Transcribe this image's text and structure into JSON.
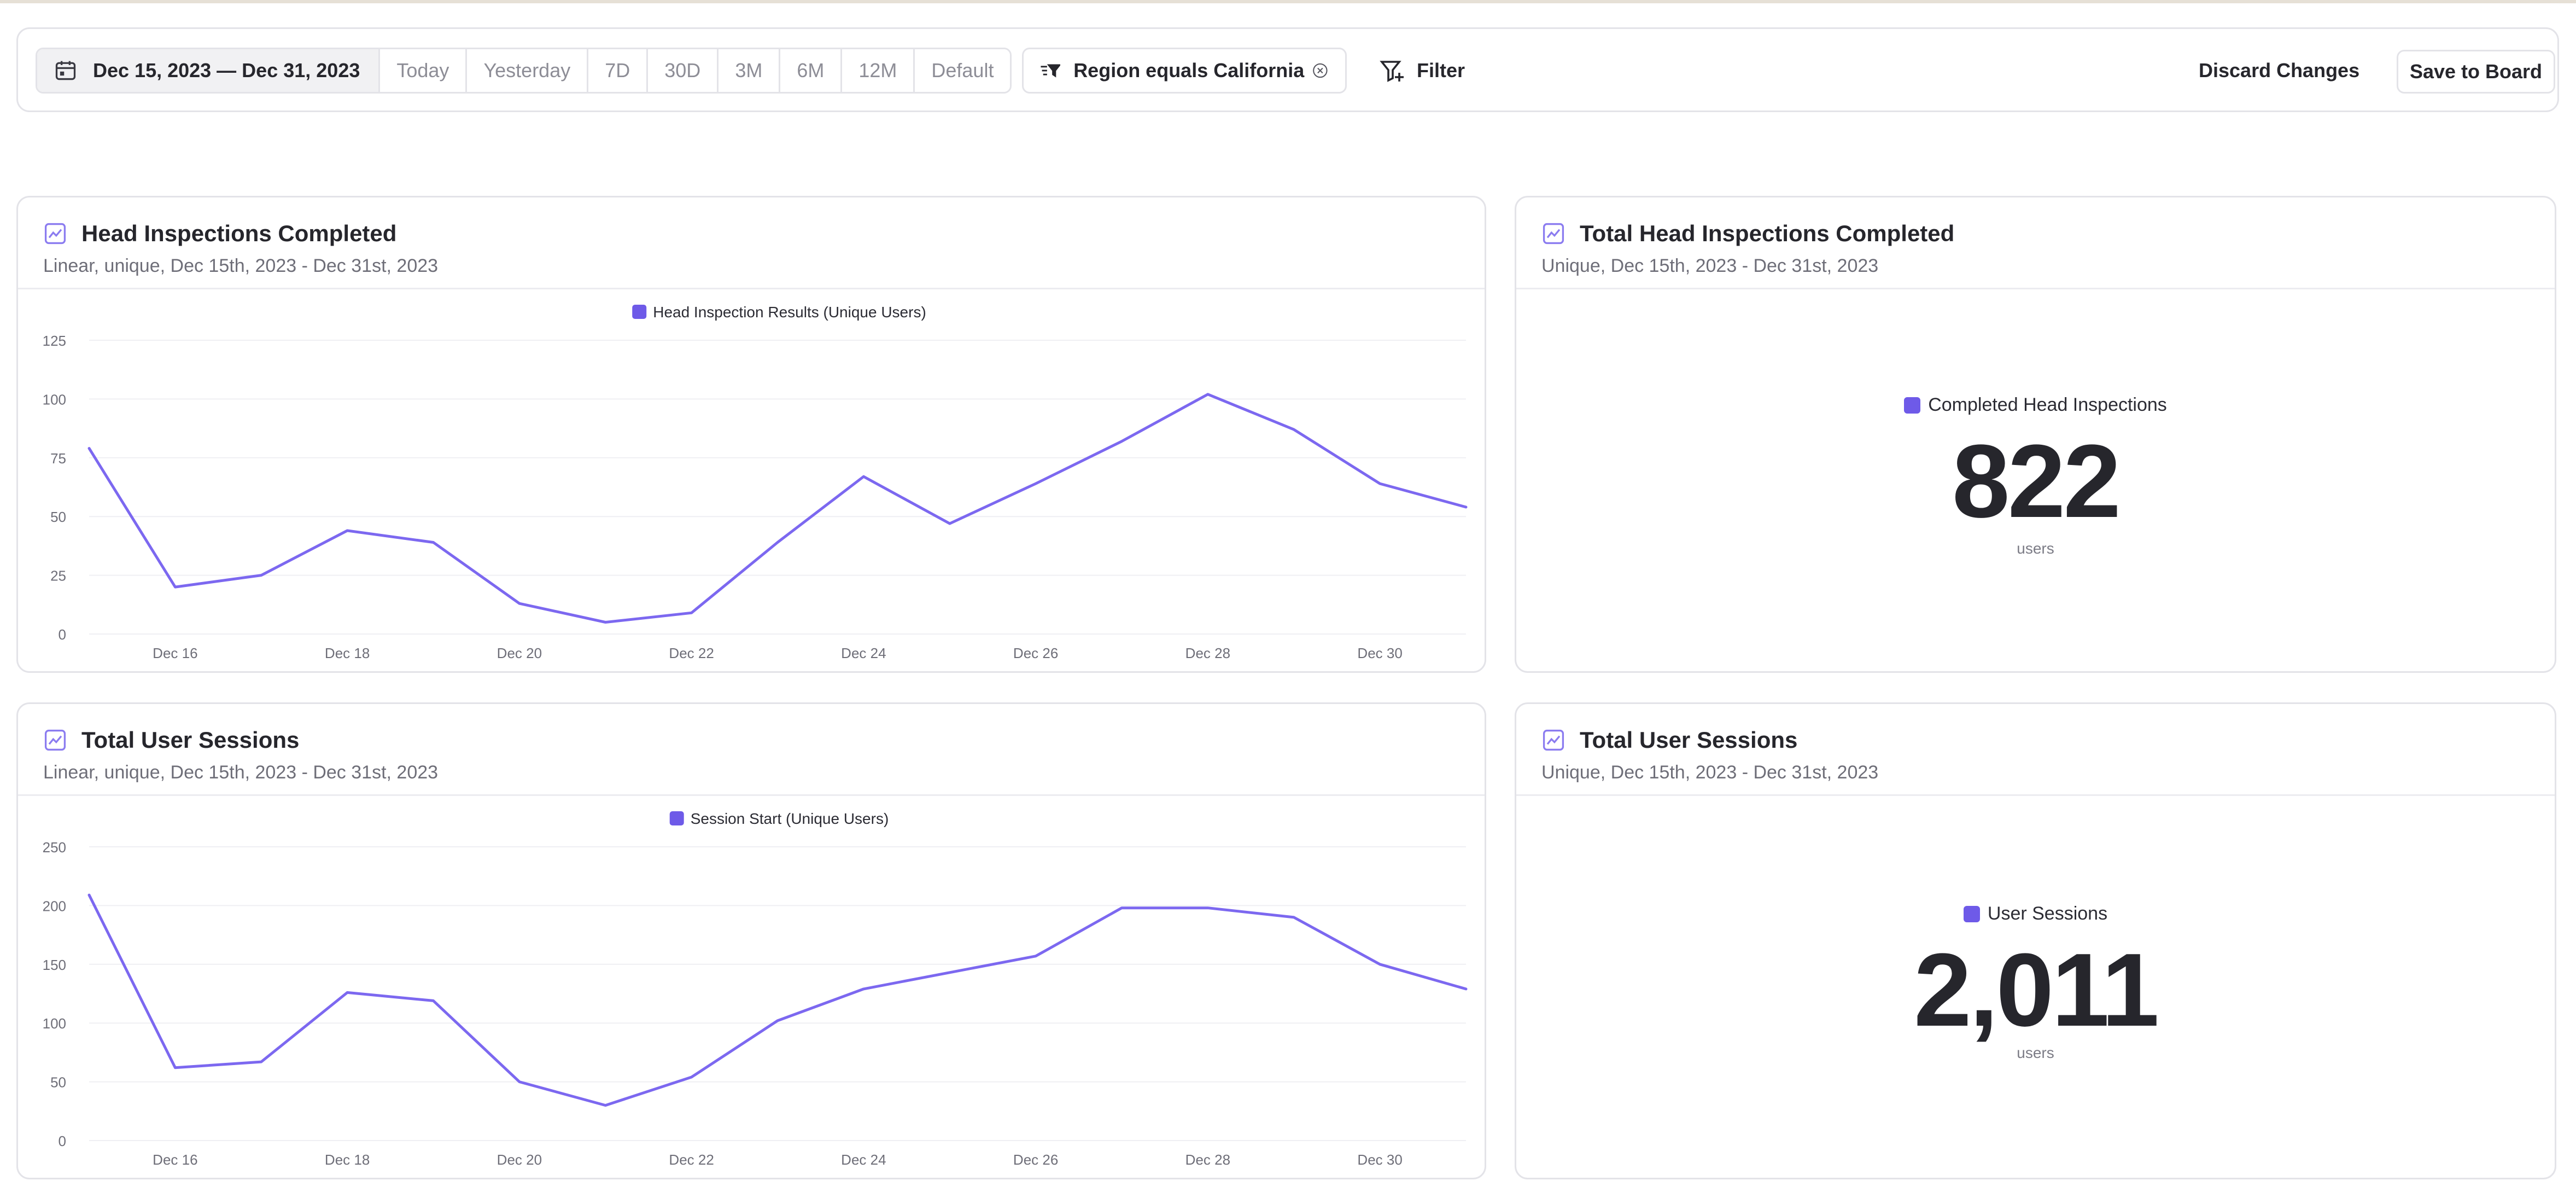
{
  "toolbar": {
    "date_range": "Dec 15, 2023 — Dec 31, 2023",
    "presets": [
      "Today",
      "Yesterday",
      "7D",
      "30D",
      "3M",
      "6M",
      "12M",
      "Default"
    ],
    "filter_chip": "Region equals California",
    "filter_label": "Filter",
    "discard_label": "Discard Changes",
    "save_label": "Save to Board"
  },
  "cards": {
    "head_chart": {
      "title": "Head Inspections Completed",
      "subtitle": "Linear, unique, Dec 15th, 2023 - Dec 31st, 2023"
    },
    "head_total": {
      "title": "Total Head Inspections Completed",
      "subtitle": "Unique, Dec 15th, 2023 - Dec 31st, 2023",
      "legend": "Completed Head Inspections",
      "value": "822",
      "unit": "users"
    },
    "sessions_chart": {
      "title": "Total User Sessions",
      "subtitle": "Linear, unique, Dec 15th, 2023 - Dec 31st, 2023"
    },
    "sessions_total": {
      "title": "Total User Sessions",
      "subtitle": "Unique, Dec 15th, 2023 - Dec 31st, 2023",
      "legend": "User Sessions",
      "value": "2,011",
      "unit": "users"
    }
  },
  "colors": {
    "series": "#7c68f0",
    "legend": "#6e5ae8",
    "grid": "#efeff3",
    "axis_text": "#6e6e78"
  },
  "chart_data": [
    {
      "type": "line",
      "x": [
        "2023-12-15",
        "2023-12-16",
        "2023-12-17",
        "2023-12-18",
        "2023-12-19",
        "2023-12-20",
        "2023-12-21",
        "2023-12-22",
        "2023-12-23",
        "2023-12-24",
        "2023-12-25",
        "2023-12-26",
        "2023-12-27",
        "2023-12-28",
        "2023-12-29",
        "2023-12-30",
        "2023-12-31"
      ],
      "x_tick_labels": [
        "Dec 16",
        "Dec 18",
        "Dec 20",
        "Dec 22",
        "Dec 24",
        "Dec 26",
        "Dec 28",
        "Dec 30"
      ],
      "series": [
        {
          "name": "Head Inspection Results (Unique Users)",
          "values": [
            79,
            20,
            25,
            44,
            39,
            13,
            5,
            9,
            39,
            67,
            47,
            64,
            82,
            102,
            87,
            64,
            54
          ]
        }
      ],
      "ylim": [
        0,
        125
      ],
      "y_ticks": [
        0,
        25,
        50,
        75,
        100,
        125
      ],
      "grid": true,
      "legend": "top-center"
    },
    {
      "type": "line",
      "x": [
        "2023-12-15",
        "2023-12-16",
        "2023-12-17",
        "2023-12-18",
        "2023-12-19",
        "2023-12-20",
        "2023-12-21",
        "2023-12-22",
        "2023-12-23",
        "2023-12-24",
        "2023-12-25",
        "2023-12-26",
        "2023-12-27",
        "2023-12-28",
        "2023-12-29",
        "2023-12-30",
        "2023-12-31"
      ],
      "x_tick_labels": [
        "Dec 16",
        "Dec 18",
        "Dec 20",
        "Dec 22",
        "Dec 24",
        "Dec 26",
        "Dec 28",
        "Dec 30"
      ],
      "series": [
        {
          "name": "Session Start (Unique Users)",
          "values": [
            209,
            62,
            67,
            126,
            119,
            50,
            30,
            54,
            102,
            129,
            143,
            157,
            198,
            198,
            190,
            150,
            129
          ]
        }
      ],
      "ylim": [
        0,
        250
      ],
      "y_ticks": [
        0,
        50,
        100,
        150,
        200,
        250
      ],
      "grid": true,
      "legend": "top-center"
    }
  ]
}
